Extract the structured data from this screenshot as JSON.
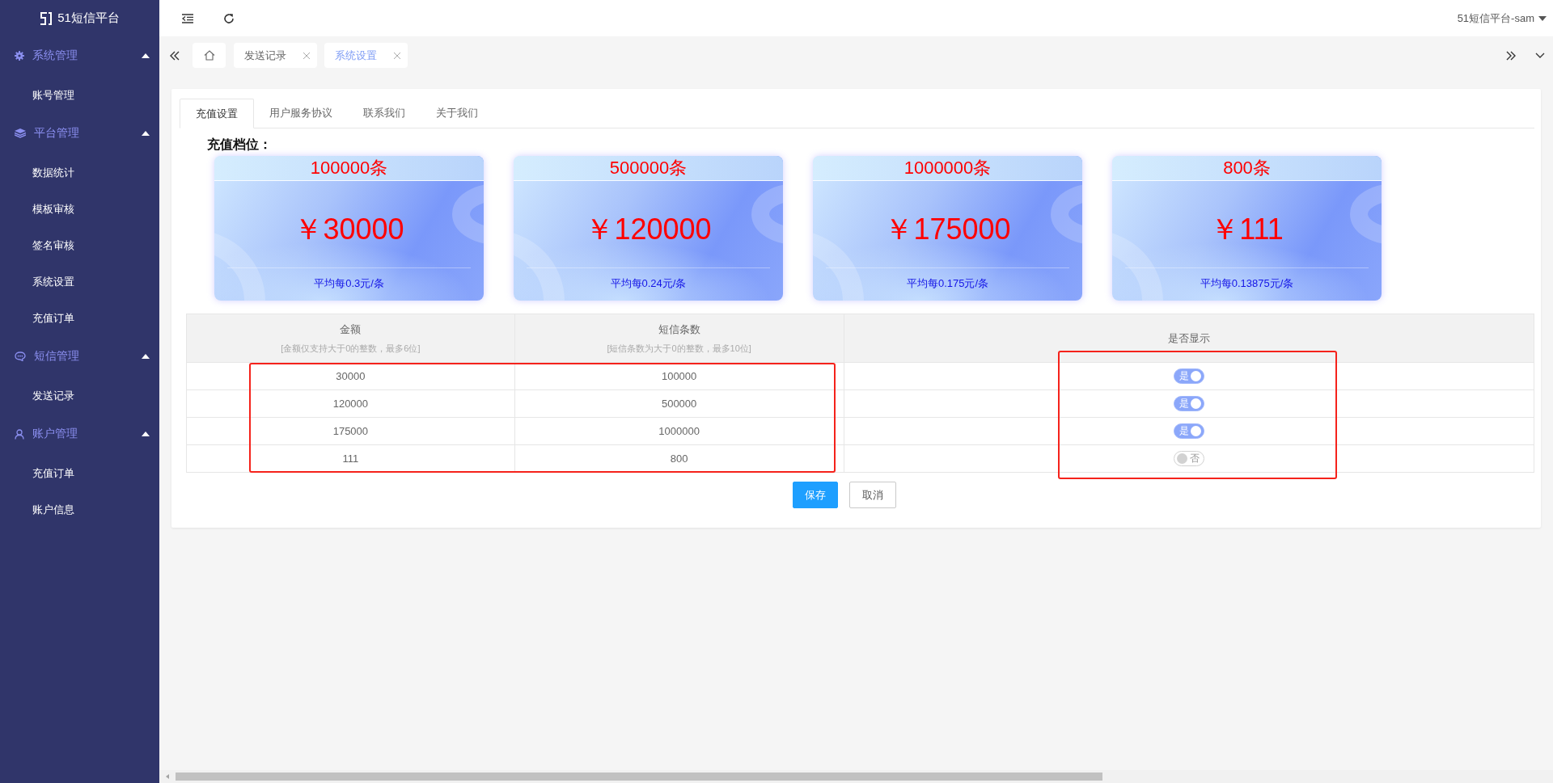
{
  "sidebar": {
    "logo": "51短信平台",
    "groups": [
      {
        "label": "系统管理",
        "expanded": true,
        "children": [
          {
            "label": "账号管理"
          }
        ]
      },
      {
        "label": "平台管理",
        "expanded": true,
        "children": [
          {
            "label": "数据统计"
          },
          {
            "label": "模板审核"
          },
          {
            "label": "签名审核"
          },
          {
            "label": "系统设置"
          },
          {
            "label": "充值订单"
          }
        ]
      },
      {
        "label": "短信管理",
        "expanded": true,
        "children": [
          {
            "label": "发送记录"
          }
        ]
      },
      {
        "label": "账户管理",
        "expanded": true,
        "children": [
          {
            "label": "充值订单"
          },
          {
            "label": "账户信息"
          }
        ]
      }
    ]
  },
  "header": {
    "user_menu": "51短信平台-sam"
  },
  "page_tabs": [
    {
      "kind": "home",
      "selected": false
    },
    {
      "kind": "page",
      "label": "发送记录",
      "selected": false
    },
    {
      "kind": "page",
      "label": "系统设置",
      "selected": true
    }
  ],
  "settings_tabs": [
    {
      "label": "充值设置",
      "selected": true
    },
    {
      "label": "用户服务协议",
      "selected": false
    },
    {
      "label": "联系我们",
      "selected": false
    },
    {
      "label": "关于我们",
      "selected": false
    }
  ],
  "tier_section": {
    "title": "充值档位：",
    "tiers": [
      {
        "count": "100000条",
        "price": "￥30000",
        "average": "平均每0.3元/条"
      },
      {
        "count": "500000条",
        "price": "￥120000",
        "average": "平均每0.24元/条"
      },
      {
        "count": "1000000条",
        "price": "￥175000",
        "average": "平均每0.175元/条"
      },
      {
        "count": "800条",
        "price": "￥111",
        "average": "平均每0.13875元/条"
      }
    ]
  },
  "table": {
    "columns": [
      {
        "kind": "text",
        "title": "金额",
        "hint": "[金额仅支持大于0的整数，最多6位]",
        "highlighted": true
      },
      {
        "kind": "text",
        "title": "短信条数",
        "hint": "[短信条数为大于0的整数，最多10位]",
        "highlighted": true
      },
      {
        "kind": "switch",
        "title": "是否显示",
        "highlighted": true
      }
    ],
    "rows": [
      {
        "cells": [
          {
            "text": "30000"
          },
          {
            "text": "100000"
          },
          {
            "on": true,
            "label": "是"
          }
        ]
      },
      {
        "cells": [
          {
            "text": "120000"
          },
          {
            "text": "500000"
          },
          {
            "on": true,
            "label": "是"
          }
        ]
      },
      {
        "cells": [
          {
            "text": "175000"
          },
          {
            "text": "1000000"
          },
          {
            "on": true,
            "label": "是"
          }
        ]
      },
      {
        "cells": [
          {
            "text": "111"
          },
          {
            "text": "800"
          },
          {
            "on": false,
            "label": "否"
          }
        ]
      }
    ]
  },
  "buttons": [
    {
      "kind": "primary",
      "label": "保存"
    },
    {
      "kind": "default",
      "label": "取消"
    }
  ]
}
